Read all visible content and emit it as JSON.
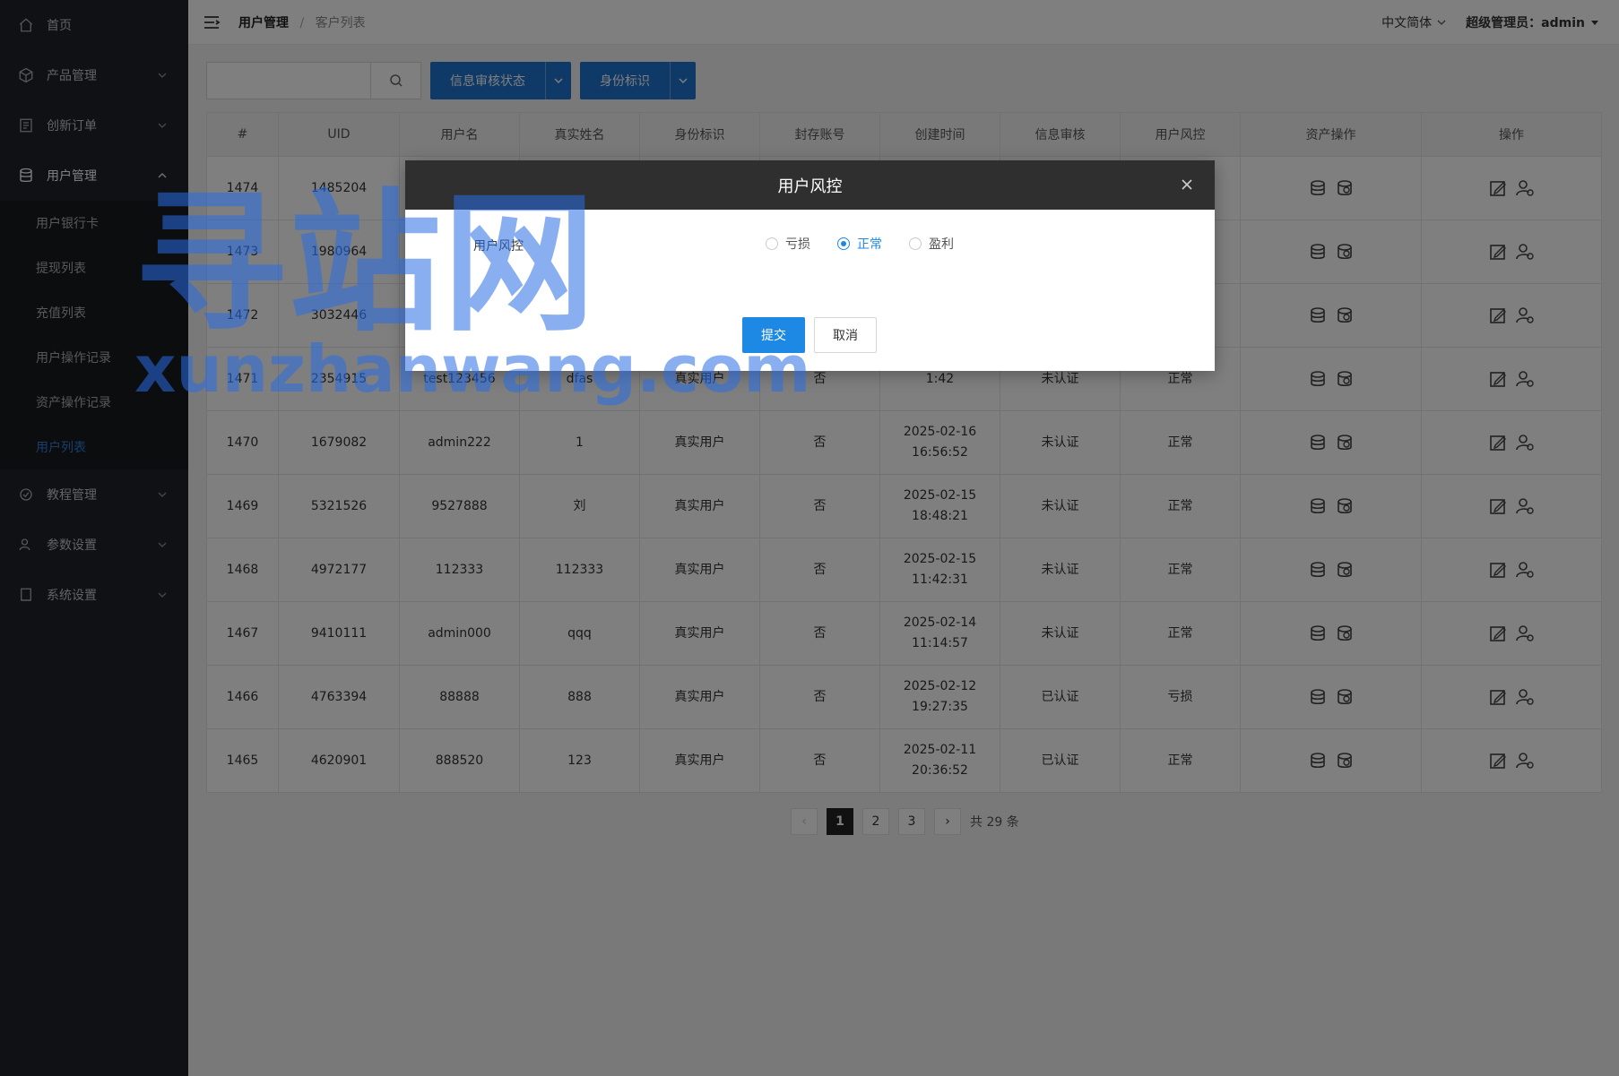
{
  "sidebar": {
    "items": [
      {
        "label": "首页",
        "icon": "home-icon"
      },
      {
        "label": "产品管理",
        "icon": "cube-icon"
      },
      {
        "label": "创新订单",
        "icon": "order-icon"
      },
      {
        "label": "用户管理",
        "icon": "database-icon"
      },
      {
        "label": "教程管理",
        "icon": "tutorial-icon"
      },
      {
        "label": "参数设置",
        "icon": "user-settings-icon"
      },
      {
        "label": "系统设置",
        "icon": "book-icon"
      }
    ],
    "submenu": [
      "用户银行卡",
      "提现列表",
      "充值列表",
      "用户操作记录",
      "资产操作记录",
      "用户列表"
    ]
  },
  "header": {
    "crumb_parent": "用户管理",
    "crumb_current": "客户列表",
    "language": "中文简体",
    "admin": "超级管理员：admin"
  },
  "filters": {
    "search_placeholder": "",
    "audit_button": "信息审核状态",
    "identity_button": "身份标识"
  },
  "table": {
    "headers": [
      "#",
      "UID",
      "用户名",
      "真实姓名",
      "身份标识",
      "封存账号",
      "创建时间",
      "信息审核",
      "用户风控",
      "资产操作",
      "操作"
    ],
    "rows": [
      [
        "1474",
        "1485204",
        "",
        "",
        "",
        "",
        "",
        "",
        "",
        "",
        ""
      ],
      [
        "1473",
        "1980964",
        "",
        "",
        "",
        "",
        "",
        "",
        "",
        "",
        ""
      ],
      [
        "1472",
        "3032446",
        "",
        "",
        "",
        "",
        "",
        "",
        "",
        "",
        ""
      ],
      [
        "1471",
        "2354915",
        "test123456",
        "dfas",
        "真实用户",
        "否",
        "1:42",
        "未认证",
        "正常",
        "",
        ""
      ],
      [
        "1470",
        "1679082",
        "admin222",
        "1",
        "真实用户",
        "否",
        "2025-02-16 16:56:52",
        "未认证",
        "正常",
        "",
        ""
      ],
      [
        "1469",
        "5321526",
        "9527888",
        "刘",
        "真实用户",
        "否",
        "2025-02-15 18:48:21",
        "未认证",
        "正常",
        "",
        ""
      ],
      [
        "1468",
        "4972177",
        "112333",
        "112333",
        "真实用户",
        "否",
        "2025-02-15 11:42:31",
        "未认证",
        "正常",
        "",
        ""
      ],
      [
        "1467",
        "9410111",
        "admin000",
        "qqq",
        "真实用户",
        "否",
        "2025-02-14 11:14:57",
        "未认证",
        "正常",
        "",
        ""
      ],
      [
        "1466",
        "4763394",
        "88888",
        "888",
        "真实用户",
        "否",
        "2025-02-12 19:27:35",
        "已认证",
        "亏损",
        "",
        ""
      ],
      [
        "1465",
        "4620901",
        "888520",
        "123",
        "真实用户",
        "否",
        "2025-02-11 20:36:52",
        "已认证",
        "正常",
        "",
        ""
      ]
    ]
  },
  "pagination": {
    "pages": [
      "1",
      "2",
      "3"
    ],
    "active": "1",
    "prev": "‹",
    "next": "›",
    "total": "共 29 条"
  },
  "modal": {
    "title": "用户风控",
    "field_label": "用户风控",
    "options": [
      "亏损",
      "正常",
      "盈利"
    ],
    "selected": "正常",
    "submit": "提交",
    "cancel": "取消",
    "close": "×"
  },
  "watermark": {
    "text_cn": "寻站网",
    "text_en": "xunzhanwang.com"
  },
  "colors": {
    "sidebar_bg": "#20222a",
    "primary": "#1e88e5",
    "button_blue": "#1e72cc",
    "active_menu": "#2f7cd8"
  }
}
